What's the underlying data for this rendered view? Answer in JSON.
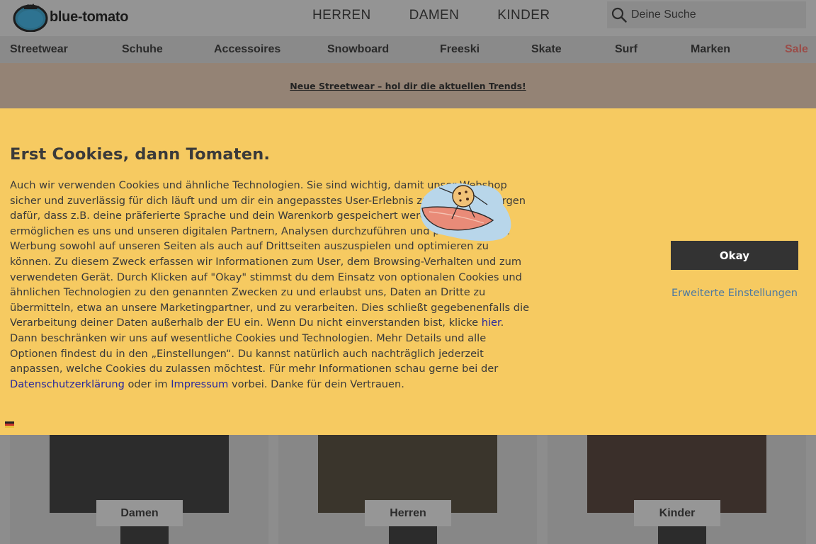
{
  "header": {
    "logo_text": "blue-tomato",
    "nav": [
      "HERREN",
      "DAMEN",
      "KINDER"
    ],
    "search_placeholder": "Deine Suche",
    "icons": {
      "search": "search-icon",
      "logo": "tomato-logo-icon"
    }
  },
  "categories": [
    "Streetwear",
    "Schuhe",
    "Accessoires",
    "Snowboard",
    "Freeski",
    "Skate",
    "Surf",
    "Marken",
    "Sale"
  ],
  "promo": {
    "text": "Neue Streetwear – hol dir die aktuellen Trends!"
  },
  "cookie": {
    "title": "Erst Cookies, dann Tomaten.",
    "body_1": "Auch wir verwenden Cookies und ähnliche Technologien. Sie sind wichtig, damit unser Webshop sicher und zuverlässig für dich läuft und um dir ein angepasstes User-Erlebnis zu bieten. Sie sorgen dafür, dass z.B. deine präferierte Sprache und dein Warenkorb gespeichert werden. Cookies ermöglichen es uns und unseren digitalen Partnern, Analysen durchzuführen und personalisierte Werbung sowohl auf unseren Seiten als auch auf Drittseiten auszuspielen und optimieren zu können. Zu diesem Zweck erfassen wir Informationen zum User, dem Browsing-Verhalten und zum verwendeten Gerät. Durch Klicken auf \"Okay\" stimmst du dem Einsatz von optionalen Cookies und ähnlichen Technologien zu den genannten Zwecken zu und erlaubst uns, Daten an Dritte zu übermitteln, etwa an unsere Marketingpartner, und zu verarbeiten. Dies schließt gegebenenfalls die Verarbeitung deiner Daten außerhalb der EU ein. Wenn Du nicht einverstanden bist, klicke ",
    "link_hier": "hier",
    "body_2": ". Dann beschränken wir uns auf wesentliche Cookies und Technologien. Mehr Details und alle Optionen findest du in den „Einstellungen“. Du kannst natürlich auch nachträglich jederzeit anpassen, welche Cookies du zulassen möchtest. Für mehr Informationen schau gerne bei der ",
    "link_privacy": "Datenschutzerklärung",
    "body_3": " oder im ",
    "link_imprint": "Impressum",
    "body_4": " vorbei. Danke für dein Vertrauen.",
    "okay_label": "Okay",
    "settings_label": "Erweiterte Einstellungen",
    "language_flag": "german-flag-icon"
  },
  "tiles": [
    {
      "label": "Damen"
    },
    {
      "label": "Herren"
    },
    {
      "label": "Kinder"
    }
  ],
  "colors": {
    "banner": "#f6ca61",
    "button": "#333333",
    "link": "#27279e",
    "settings_link": "#4e7aa0",
    "sale": "#9a4d49"
  }
}
